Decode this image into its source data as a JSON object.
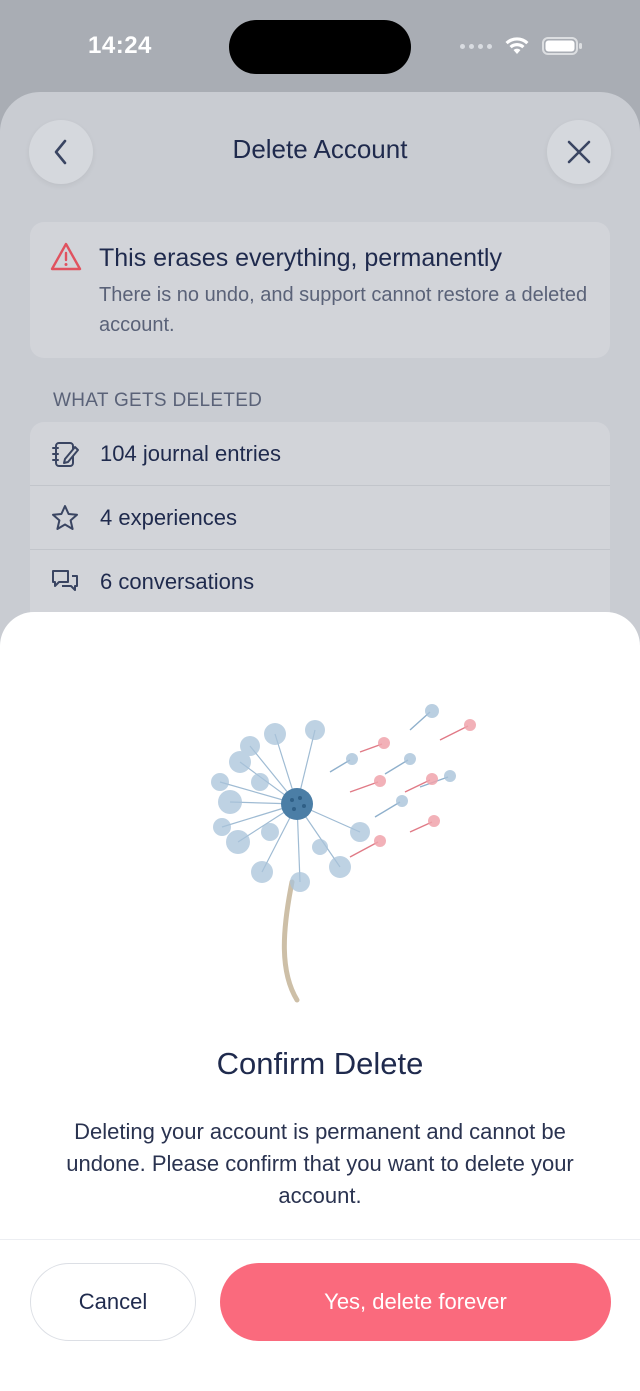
{
  "status_bar": {
    "time": "14:24"
  },
  "header": {
    "title": "Delete Account"
  },
  "warning": {
    "title": "This erases everything, permanently",
    "subtitle": "There is no undo, and support cannot restore a deleted account."
  },
  "deleted_section": {
    "label": "WHAT GETS DELETED",
    "items": [
      {
        "icon": "journal-icon",
        "label": "104 journal entries"
      },
      {
        "icon": "star-icon",
        "label": "4 experiences"
      },
      {
        "icon": "chat-bubbles-icon",
        "label": "6 conversations"
      }
    ]
  },
  "dialog": {
    "title": "Confirm Delete",
    "body": "Deleting your account is permanent and cannot be undone. Please confirm that you want to delete your account.",
    "cancel_label": "Cancel",
    "confirm_label": "Yes, delete forever"
  },
  "colors": {
    "accent_danger": "#fa6a7d",
    "text_primary": "#1f2a4d",
    "warning_icon": "#e0525f"
  }
}
